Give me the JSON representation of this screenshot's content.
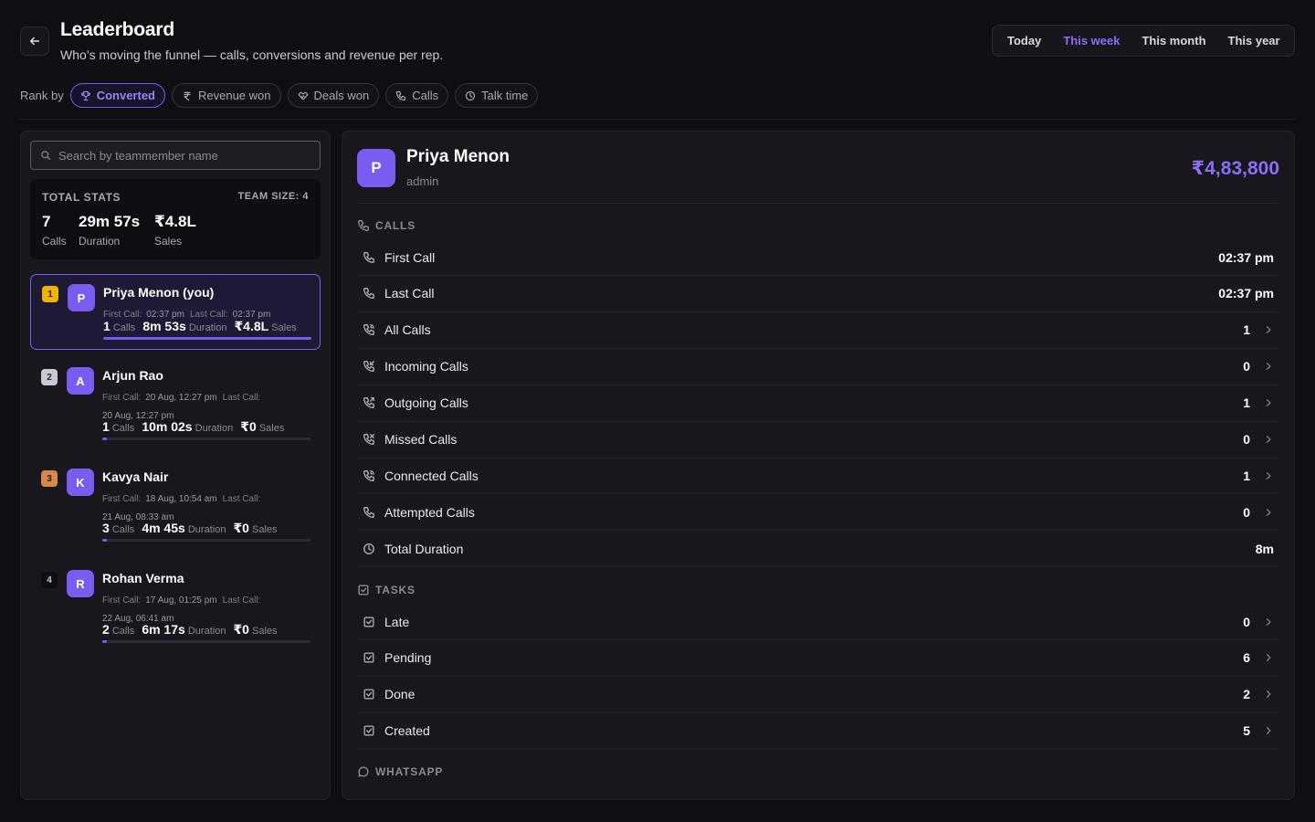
{
  "header": {
    "title": "Leaderboard",
    "subtitle": "Who’s moving the funnel — calls, conversions and revenue per rep."
  },
  "period": {
    "options": [
      "Today",
      "This week",
      "This month",
      "This year"
    ],
    "selected": "This week"
  },
  "rank_by": {
    "label": "Rank by",
    "options": [
      {
        "label": "Converted",
        "icon": "trophy-icon",
        "active": true
      },
      {
        "label": "Revenue won",
        "icon": "rupee-icon",
        "active": false
      },
      {
        "label": "Deals won",
        "icon": "handshake-icon",
        "active": false
      },
      {
        "label": "Calls",
        "icon": "phone-icon",
        "active": false
      },
      {
        "label": "Talk time",
        "icon": "clock-icon",
        "active": false
      }
    ]
  },
  "search": {
    "placeholder": "Search by teammember name"
  },
  "total_stats": {
    "title": "TOTAL STATS",
    "team_size": "TEAM SIZE: 4",
    "calls_value": "7",
    "calls_label": "Calls",
    "duration_value": "29m 57s",
    "duration_label": "Duration",
    "sales_value": "₹4.8L",
    "sales_label": "Sales"
  },
  "members": [
    {
      "rank": "1",
      "initial": "P",
      "name": "Priya Menon (you)",
      "first_call_label": "First Call:",
      "first_call": "02:37 pm",
      "last_call_label": "Last Call:",
      "last_call": "02:37 pm",
      "calls": "1",
      "calls_label": "Calls",
      "duration": "8m 53s",
      "duration_label": "Duration",
      "sales": "₹4.8L",
      "sales_label": "Sales",
      "progress": 1.0
    },
    {
      "rank": "2",
      "initial": "A",
      "name": "Arjun Rao",
      "first_call_label": "First Call:",
      "first_call": "20 Aug, 12:27 pm",
      "last_call_label": "Last Call:",
      "last_call": "20 Aug, 12:27 pm",
      "calls": "1",
      "calls_label": "Calls",
      "duration": "10m 02s",
      "duration_label": "Duration",
      "sales": "₹0",
      "sales_label": "Sales",
      "progress": 0.02
    },
    {
      "rank": "3",
      "initial": "K",
      "name": "Kavya Nair",
      "first_call_label": "First Call:",
      "first_call": "18 Aug, 10:54 am",
      "last_call_label": "Last Call:",
      "last_call": "21 Aug, 08:33 am",
      "calls": "3",
      "calls_label": "Calls",
      "duration": "4m 45s",
      "duration_label": "Duration",
      "sales": "₹0",
      "sales_label": "Sales",
      "progress": 0.02
    },
    {
      "rank": "4",
      "initial": "R",
      "name": "Rohan Verma",
      "first_call_label": "First Call:",
      "first_call": "17 Aug, 01:25 pm",
      "last_call_label": "Last Call:",
      "last_call": "22 Aug, 06:41 am",
      "calls": "2",
      "calls_label": "Calls",
      "duration": "6m 17s",
      "duration_label": "Duration",
      "sales": "₹0",
      "sales_label": "Sales",
      "progress": 0.02
    }
  ],
  "detail": {
    "initial": "P",
    "name": "Priya Menon",
    "role": "admin",
    "revenue": "₹4,83,800",
    "calls_section": "CALLS",
    "calls": [
      {
        "label": "First Call",
        "value": "02:37 pm",
        "icon": "phone-icon",
        "chevron": false
      },
      {
        "label": "Last Call",
        "value": "02:37 pm",
        "icon": "phone-icon",
        "chevron": false
      },
      {
        "label": "All Calls",
        "value": "1",
        "icon": "phone-ring-icon",
        "chevron": true
      },
      {
        "label": "Incoming Calls",
        "value": "0",
        "icon": "phone-incoming-icon",
        "chevron": true
      },
      {
        "label": "Outgoing Calls",
        "value": "1",
        "icon": "phone-outgoing-icon",
        "chevron": true
      },
      {
        "label": "Missed Calls",
        "value": "0",
        "icon": "phone-missed-icon",
        "chevron": true
      },
      {
        "label": "Connected Calls",
        "value": "1",
        "icon": "phone-ring-icon",
        "chevron": true
      },
      {
        "label": "Attempted Calls",
        "value": "0",
        "icon": "phone-icon",
        "chevron": true
      },
      {
        "label": "Total Duration",
        "value": "8m",
        "icon": "clock-icon",
        "chevron": false
      }
    ],
    "tasks_section": "TASKS",
    "tasks": [
      {
        "label": "Late",
        "value": "0",
        "icon": "checkbox-icon",
        "chevron": true
      },
      {
        "label": "Pending",
        "value": "6",
        "icon": "checkbox-icon",
        "chevron": true
      },
      {
        "label": "Done",
        "value": "2",
        "icon": "checkbox-icon",
        "chevron": true
      },
      {
        "label": "Created",
        "value": "5",
        "icon": "checkbox-icon",
        "chevron": true
      }
    ],
    "whatsapp_section": "WHATSAPP"
  },
  "colors": {
    "accent": "#7b5cf0",
    "rank_gold": "#f0b400",
    "rank_silver": "#c9c9d3",
    "rank_bronze": "#d88848"
  }
}
